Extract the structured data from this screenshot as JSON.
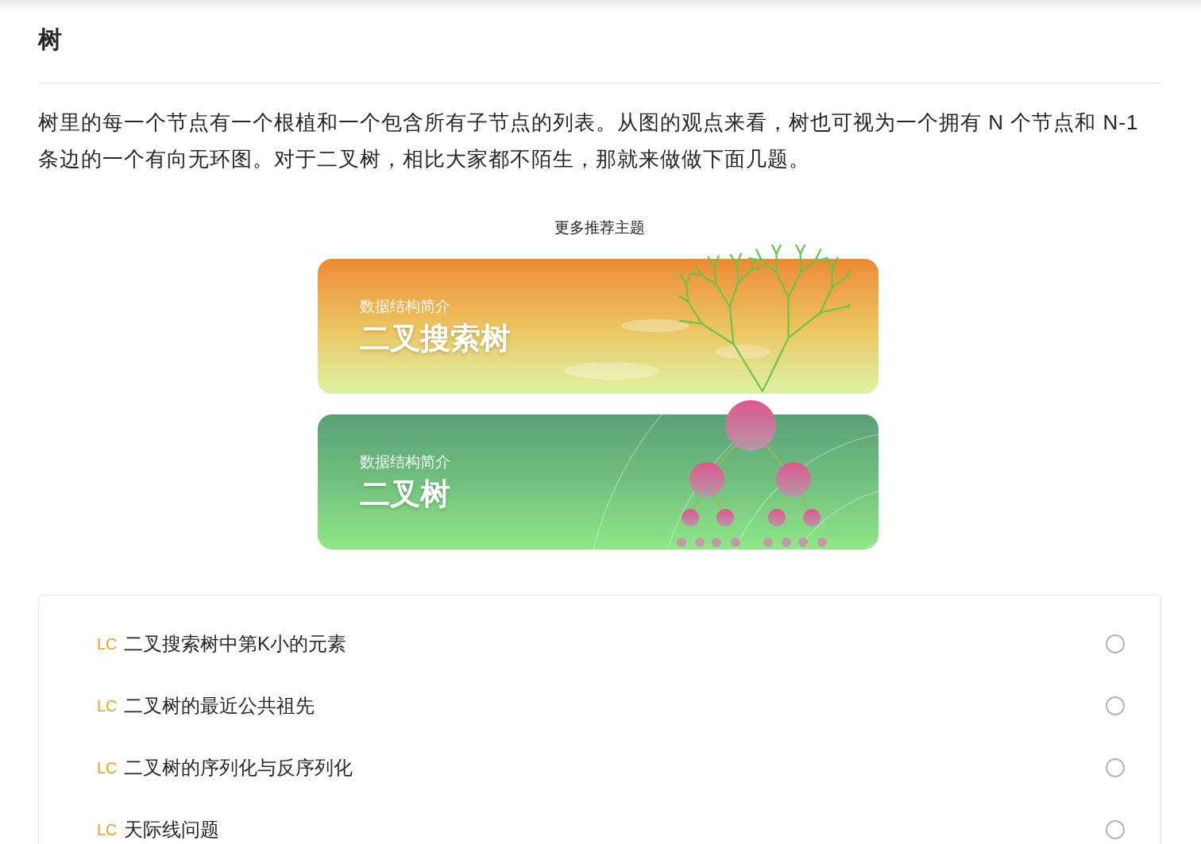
{
  "title": "树",
  "intro": "树里的每一个节点有一个根植和一个包含所有子节点的列表。从图的观点来看，树也可视为一个拥有 N 个节点和 N-1 条边的一个有向无环图。对于二叉树，相比大家都不陌生，那就来做做下面几题。",
  "recommend": {
    "caption": "更多推荐主题",
    "banners": [
      {
        "kind": "search-tree",
        "subtitle": "数据结构简介",
        "title": "二叉搜索树"
      },
      {
        "kind": "binary-tree",
        "subtitle": "数据结构简介",
        "title": "二叉树"
      }
    ]
  },
  "problems": [
    {
      "tag": "LC",
      "title": "二叉搜索树中第K小的元素",
      "done": false
    },
    {
      "tag": "LC",
      "title": "二叉树的最近公共祖先",
      "done": false
    },
    {
      "tag": "LC",
      "title": "二叉树的序列化与反序列化",
      "done": false
    },
    {
      "tag": "LC",
      "title": "天际线问题",
      "done": false
    }
  ]
}
